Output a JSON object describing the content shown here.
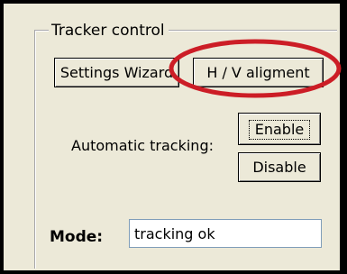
{
  "group": {
    "title": "Tracker control"
  },
  "buttons": {
    "settings_wizard": "Settings Wizard",
    "hv_alignment": "H / V aligment",
    "enable": "Enable",
    "disable": "Disable"
  },
  "automatic_tracking": {
    "label": "Automatic tracking:"
  },
  "mode": {
    "label": "Mode:",
    "value": "tracking ok"
  },
  "colors": {
    "panel_bg": "#ece9d8",
    "frame": "#000000",
    "highlight": "#cc1d26",
    "field_border": "#7f9db9"
  }
}
